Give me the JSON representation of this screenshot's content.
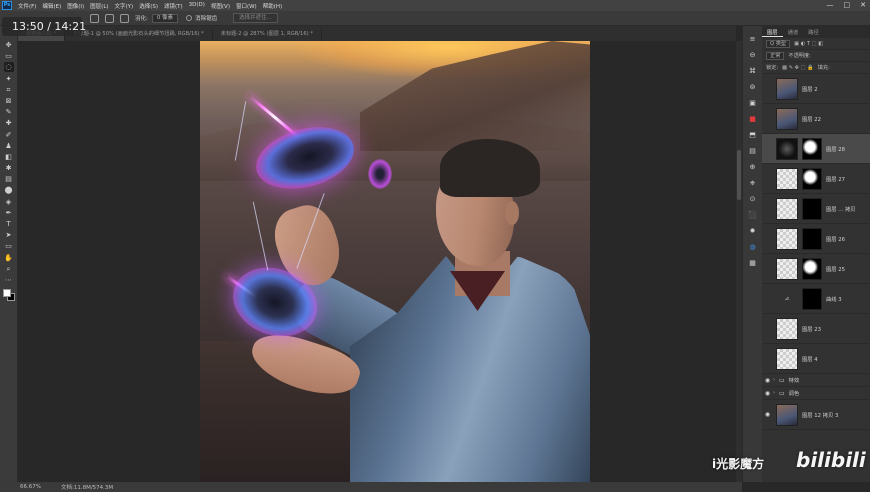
{
  "app": {
    "logo": "Ps"
  },
  "menu": [
    "文件(F)",
    "编辑(E)",
    "图像(I)",
    "图层(L)",
    "文字(Y)",
    "选择(S)",
    "滤镜(T)",
    "3D(D)",
    "视图(V)",
    "窗口(W)",
    "帮助(H)"
  ],
  "window_controls": [
    "—",
    "□",
    "✕"
  ],
  "options": {
    "feather_label": "羽化:",
    "feather_value": "0 像素",
    "antialias_label": "消除锯齿",
    "select_mask_button": "选择并遮住..."
  },
  "timer": {
    "text": "13:50 / 14:21"
  },
  "tabs": [
    {
      "label": "调整版/16) *",
      "active": true
    },
    {
      "label": "未标题-1 @ 50% (画面光影石头的细节扭踢, RGB/16) *",
      "active": false
    },
    {
      "label": "未标题-2 @ 287% (图层 1, RGB/16) *",
      "active": false
    }
  ],
  "tools": [
    "✥",
    "▭",
    "◌",
    "✦",
    "⌗",
    "⊠",
    "✎",
    "✚",
    "✐",
    "♟",
    "◧",
    "✱",
    "▤",
    "⬤",
    "◈",
    "✒",
    "T",
    "➤",
    "▭",
    "✋",
    "⌕",
    "⋯"
  ],
  "status": {
    "zoom": "66.67%",
    "doc": "文档:11.8M/574.3M"
  },
  "side_icons": [
    "≡",
    "⊖",
    "⌘",
    "⊚",
    "▣",
    "■",
    "⬒",
    "▤",
    "⊕",
    "⎈",
    "⊙",
    "⬛",
    "✹",
    "◍",
    "▦"
  ],
  "layers_panel": {
    "tabs": [
      {
        "label": "图层",
        "active": true
      },
      {
        "label": "通道",
        "active": false
      },
      {
        "label": "路径",
        "active": false
      }
    ],
    "filter_label": "Q 类型",
    "mode_label": "正常",
    "opacity_label": "不透明度:",
    "lock_label": "锁定:",
    "fill_label": "填充:",
    "layers": [
      {
        "name": "图层 2",
        "thumb": "photo",
        "mask": "none",
        "visible": false
      },
      {
        "name": "图层 22",
        "thumb": "photo",
        "mask": "none",
        "visible": false
      },
      {
        "name": "图层 28",
        "thumb": "dark",
        "mask": "white",
        "visible": false,
        "selected": true
      },
      {
        "name": "图层 27",
        "thumb": "check",
        "mask": "white",
        "visible": false
      },
      {
        "name": "图层 ... 拷贝",
        "thumb": "check",
        "mask": "black",
        "visible": false
      },
      {
        "name": "图层 26",
        "thumb": "check",
        "mask": "black",
        "visible": false
      },
      {
        "name": "图层 25",
        "thumb": "check",
        "mask": "white",
        "visible": false
      },
      {
        "name": "曲线 3",
        "thumb": "adj",
        "mask": "black",
        "visible": false
      },
      {
        "name": "图层 23",
        "thumb": "check",
        "mask": "none",
        "visible": false
      },
      {
        "name": "图层 4",
        "thumb": "check",
        "mask": "none",
        "visible": false
      }
    ],
    "groups": [
      {
        "name": "特效",
        "visible": true
      },
      {
        "name": "调色",
        "visible": true
      }
    ],
    "bottom_layer": {
      "name": "图层 12 拷贝 3",
      "visible": true
    }
  },
  "watermark": {
    "brand": "i光影魔方",
    "site": "bilibili"
  }
}
